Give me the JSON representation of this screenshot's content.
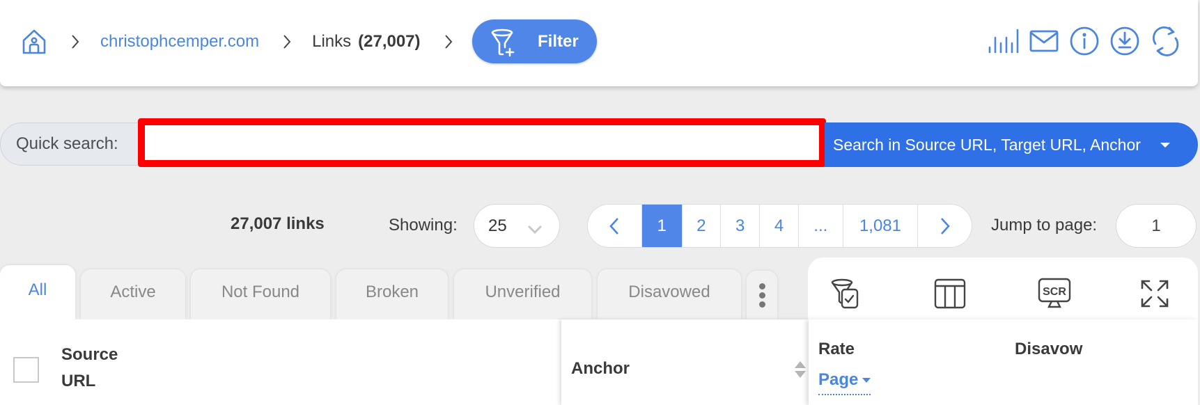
{
  "header": {
    "breadcrumb": {
      "home_icon": "home-icon",
      "domain": "christophcemper.com",
      "section": "Links",
      "section_count": "(27,007)"
    },
    "filter_button": {
      "label": "Filter",
      "icon": "filter-add-icon"
    },
    "actions": [
      {
        "name": "chart-icon"
      },
      {
        "name": "mail-icon"
      },
      {
        "name": "info-icon"
      },
      {
        "name": "download-icon"
      },
      {
        "name": "refresh-icon"
      }
    ]
  },
  "quick_search": {
    "label": "Quick search:",
    "value": "",
    "placeholder": "",
    "scope": "Search in Source URL, Target URL, Anchor"
  },
  "listing": {
    "total": "27,007 links",
    "showing_label": "Showing:",
    "per_page": "25",
    "pagination": {
      "prev": "‹",
      "pages": [
        "1",
        "2",
        "3",
        "4",
        "...",
        "1,081"
      ],
      "current": "1",
      "next": "›"
    },
    "jump_label": "Jump to page:",
    "jump_value": "1"
  },
  "tabs": [
    {
      "label": "All",
      "active": true
    },
    {
      "label": "Active",
      "active": false
    },
    {
      "label": "Not Found",
      "active": false
    },
    {
      "label": "Broken",
      "active": false
    },
    {
      "label": "Unverified",
      "active": false
    },
    {
      "label": "Disavowed",
      "active": false
    }
  ],
  "panel_tools": [
    {
      "name": "filter-check-icon"
    },
    {
      "name": "columns-icon"
    },
    {
      "name": "screenshot-icon",
      "text": "SCR"
    },
    {
      "name": "fullscreen-icon"
    }
  ],
  "table": {
    "columns": {
      "source_line1": "Source",
      "source_line2": "URL",
      "anchor": "Anchor",
      "rate": "Rate",
      "rate_selector": "Page",
      "disavow": "Disavow"
    }
  },
  "colors": {
    "accent": "#4f86e8",
    "scope_blue": "#3070e6",
    "highlight_border": "#ff0000"
  }
}
